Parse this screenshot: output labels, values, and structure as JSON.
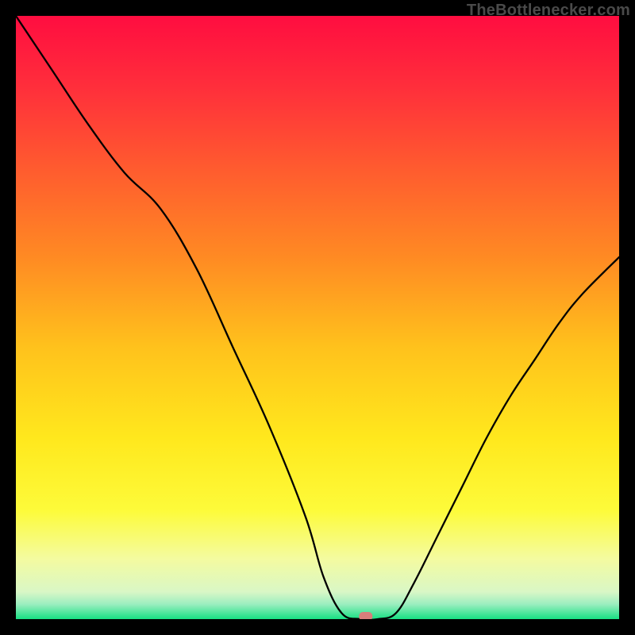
{
  "watermark": "TheBottlenecker.com",
  "chart_data": {
    "type": "line",
    "title": "",
    "xlabel": "",
    "ylabel": "",
    "xlim": [
      0,
      100
    ],
    "ylim": [
      0,
      100
    ],
    "x": [
      0,
      6,
      12,
      18,
      24,
      30,
      36,
      42,
      48,
      51,
      54,
      57,
      60,
      63,
      66,
      70,
      74,
      78,
      82,
      86,
      90,
      94,
      100
    ],
    "values": [
      100,
      91,
      82,
      74,
      68,
      58,
      45,
      32,
      17,
      7,
      1,
      0,
      0,
      1,
      6,
      14,
      22,
      30,
      37,
      43,
      49,
      54,
      60
    ],
    "minimum_marker_x": 58,
    "background": {
      "type": "vertical-gradient-with-base-stripe",
      "stops": [
        {
          "pos": 0.0,
          "color": "#ff0d40"
        },
        {
          "pos": 0.12,
          "color": "#ff2f3b"
        },
        {
          "pos": 0.25,
          "color": "#ff5a2f"
        },
        {
          "pos": 0.4,
          "color": "#ff8a23"
        },
        {
          "pos": 0.55,
          "color": "#ffc21c"
        },
        {
          "pos": 0.7,
          "color": "#ffe81d"
        },
        {
          "pos": 0.82,
          "color": "#fdfb3a"
        },
        {
          "pos": 0.9,
          "color": "#f4fba0"
        },
        {
          "pos": 0.955,
          "color": "#d9f7c6"
        },
        {
          "pos": 0.975,
          "color": "#9ceec0"
        },
        {
          "pos": 1.0,
          "color": "#17e083"
        }
      ]
    }
  }
}
